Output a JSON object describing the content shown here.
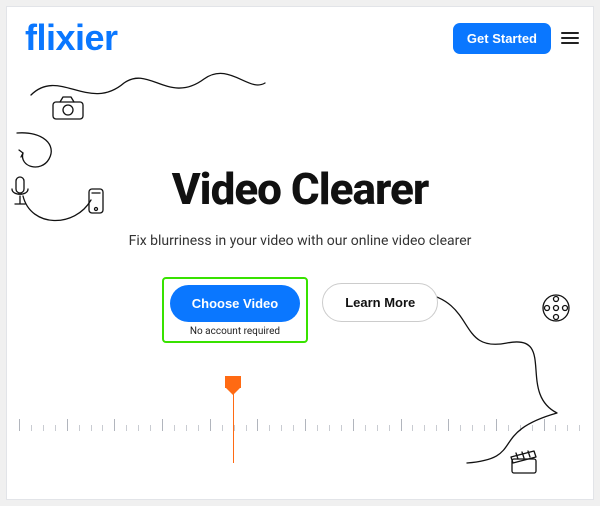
{
  "header": {
    "logo_text": "flixier",
    "cta": "Get Started"
  },
  "hero": {
    "title": "Video Clearer",
    "subtitle": "Fix blurriness in your video with our online video clearer",
    "choose_label": "Choose Video",
    "choose_sub": "No account required",
    "learn_label": "Learn More"
  },
  "colors": {
    "brand_blue": "#0a77ff",
    "playhead_orange": "#ff6a13",
    "highlight_green": "#38e200"
  }
}
